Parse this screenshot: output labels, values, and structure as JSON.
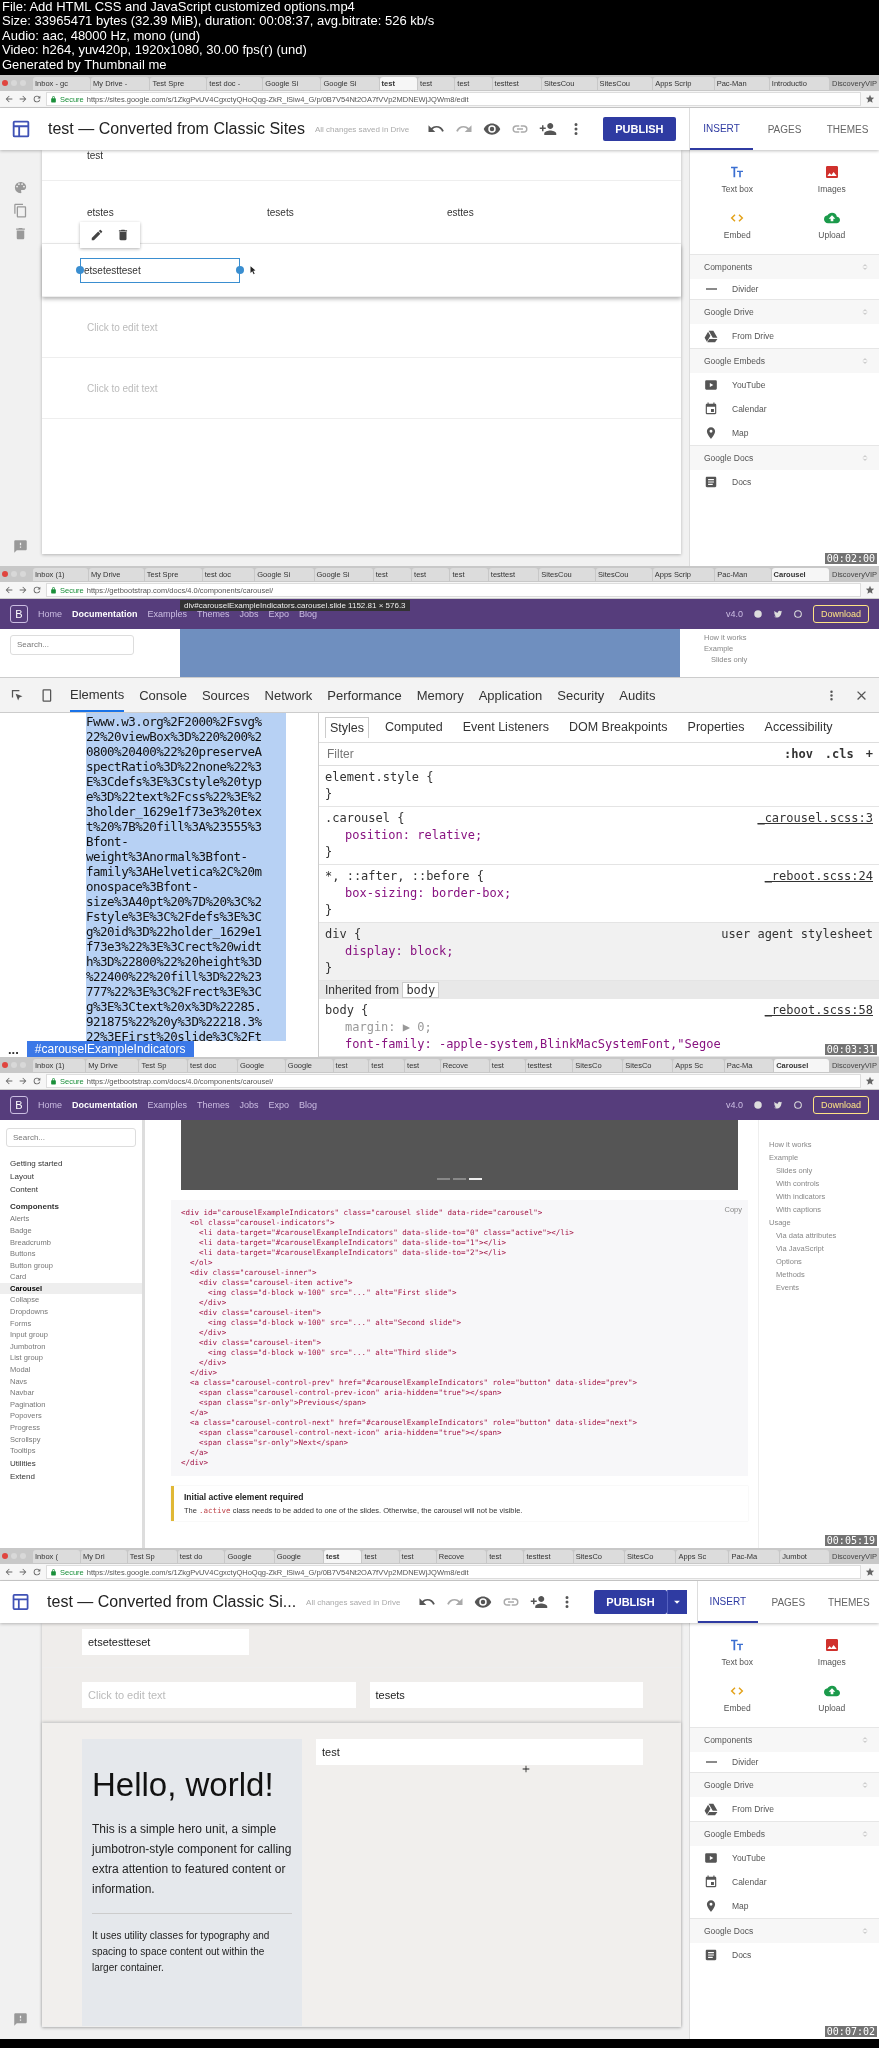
{
  "file_info": [
    "File: Add HTML CSS and JavaScript customized options.mp4",
    "Size: 33965471 bytes (32.39 MiB), duration: 00:08:37, avg.bitrate: 526 kb/s",
    "Audio: aac, 48000 Hz, mono (und)",
    "Video: h264, yuv420p, 1920x1080, 30.00 fps(r) (und)",
    "Generated by Thumbnail me"
  ],
  "frames": [
    {
      "kind": "sites",
      "timestamp": "00:02:00",
      "browser": {
        "tabs": [
          {
            "label": "Inbox - gc",
            "selected": false
          },
          {
            "label": "My Drive -",
            "selected": false
          },
          {
            "label": "Test Spre",
            "selected": false
          },
          {
            "label": "test doc -",
            "selected": false
          },
          {
            "label": "Google Si",
            "selected": false
          },
          {
            "label": "Google Si",
            "selected": false
          },
          {
            "label": "test",
            "selected": true
          },
          {
            "label": "test",
            "selected": false
          },
          {
            "label": "test",
            "selected": false
          },
          {
            "label": "testtest",
            "selected": false
          },
          {
            "label": "SitesCou",
            "selected": false
          },
          {
            "label": "SitesCou",
            "selected": false
          },
          {
            "label": "Apps Scrip",
            "selected": false
          },
          {
            "label": "Pac-Man",
            "selected": false
          },
          {
            "label": "Introductio",
            "selected": false
          }
        ],
        "profile": "DiscoveryVIP",
        "secure": "Secure",
        "url": "https://sites.google.com/s/1ZkgPvUV4CgxctyQHoQqg-ZkR_lSiw4_G/p/0B7V54Nt2OA7fVVp2MDNEWjJQWm8/edit"
      },
      "app": {
        "title": "test — Converted from Classic Sites",
        "save_status": "All changes saved in Drive",
        "publish": "PUBLISH",
        "publish_menu": false
      },
      "panel": {
        "tabs": [
          {
            "label": "INSERT",
            "selected": true
          },
          {
            "label": "PAGES",
            "selected": false
          },
          {
            "label": "THEMES",
            "selected": false
          }
        ],
        "tiles": [
          {
            "label": "Text box",
            "kind": "textbox"
          },
          {
            "label": "Images",
            "kind": "image"
          },
          {
            "label": "Embed",
            "kind": "embed"
          },
          {
            "label": "Upload",
            "kind": "upload"
          }
        ],
        "sections": [
          {
            "title": "Components",
            "items": [
              {
                "label": "Divider",
                "kind": "divider"
              }
            ]
          },
          {
            "title": "Google Drive",
            "items": [
              {
                "label": "From Drive",
                "kind": "drive"
              }
            ]
          },
          {
            "title": "Google Embeds",
            "items": [
              {
                "label": "YouTube",
                "kind": "youtube"
              },
              {
                "label": "Calendar",
                "kind": "calendar"
              },
              {
                "label": "Map",
                "kind": "map"
              }
            ]
          },
          {
            "title": "Google Docs",
            "items": [
              {
                "label": "Docs",
                "kind": "docs"
              }
            ]
          }
        ]
      },
      "canvas": {
        "kind": "text_rows",
        "top_text": "test",
        "columns": [
          "etstes",
          "tesets",
          "esttes"
        ],
        "selected_text": "etsetestteset",
        "placeholders": [
          "Click to edit text",
          "Click to edit text"
        ]
      }
    },
    {
      "kind": "devtools",
      "timestamp": "00:03:31",
      "browser": {
        "tabs": [
          {
            "label": "Inbox (1)",
            "selected": false
          },
          {
            "label": "My Drive",
            "selected": false
          },
          {
            "label": "Test Spre",
            "selected": false
          },
          {
            "label": "test doc",
            "selected": false
          },
          {
            "label": "Google Si",
            "selected": false
          },
          {
            "label": "Google Si",
            "selected": false
          },
          {
            "label": "test",
            "selected": false
          },
          {
            "label": "test",
            "selected": false
          },
          {
            "label": "test",
            "selected": false
          },
          {
            "label": "testtest",
            "selected": false
          },
          {
            "label": "SitesCou",
            "selected": false
          },
          {
            "label": "SitesCou",
            "selected": false
          },
          {
            "label": "Apps Scrip",
            "selected": false
          },
          {
            "label": "Pac-Man",
            "selected": false
          },
          {
            "label": "Carousel",
            "selected": true
          }
        ],
        "profile": "DiscoveryVIP",
        "secure": "Secure",
        "url": "https://getbootstrap.com/docs/4.0/components/carousel/"
      },
      "site": {
        "logo": "B",
        "nav": [
          {
            "label": "Home",
            "selected": false
          },
          {
            "label": "Documentation",
            "selected": true
          },
          {
            "label": "Examples",
            "selected": false
          },
          {
            "label": "Themes",
            "selected": false
          },
          {
            "label": "Jobs",
            "selected": false
          },
          {
            "label": "Expo",
            "selected": false
          },
          {
            "label": "Blog",
            "selected": false
          }
        ],
        "version": "v4.0",
        "download": "Download"
      },
      "tooltip": {
        "selector": "div#carouselExampleIndicators.carousel.slide",
        "size": "1152.81 × 576.3"
      },
      "search_placeholder": "Search...",
      "toc": [
        "How it works",
        "Example",
        "Slides only"
      ],
      "devtools": {
        "tabs": [
          {
            "label": "Elements",
            "selected": true
          },
          {
            "label": "Console",
            "selected": false
          },
          {
            "label": "Sources",
            "selected": false
          },
          {
            "label": "Network",
            "selected": false
          },
          {
            "label": "Performance",
            "selected": false
          },
          {
            "label": "Memory",
            "selected": false
          },
          {
            "label": "Application",
            "selected": false
          },
          {
            "label": "Security",
            "selected": false
          },
          {
            "label": "Audits",
            "selected": false
          }
        ],
        "source_lines": [
          "Fwww.w3.org%2F2000%2Fsvg%",
          "22%20viewBox%3D%220%200%2",
          "0800%20400%22%20preserveA",
          "spectRatio%3D%22none%22%3",
          "E%3Cdefs%3E%3Cstyle%20typ",
          "e%3D%22text%2Fcss%22%3E%2",
          "3holder_1629e1f73e3%20tex",
          "t%20%7B%20fill%3A%23555%3",
          "Bfont-",
          "weight%3Anormal%3Bfont-",
          "family%3AHelvetica%2C%20m",
          "onospace%3Bfont-",
          "size%3A40pt%20%7D%20%3C%2",
          "Fstyle%3E%3C%2Fdefs%3E%3C",
          "g%20id%3D%22holder_1629e1",
          "f73e3%22%3E%3Crect%20widt",
          "h%3D%22800%22%20height%3D",
          "%22400%22%20fill%3D%22%23",
          "777%22%3E%3C%2Frect%3E%3C",
          "g%3E%3Ctext%20x%3D%22285.",
          "921875%22%20y%3D%22218.3%",
          "22%3EFirst%20slide%3C%2Ft"
        ],
        "breadcrumb_more": "...",
        "breadcrumb": "#carouselExampleIndicators",
        "pane_tabs": [
          {
            "label": "Styles",
            "selected": true
          },
          {
            "label": "Computed",
            "selected": false
          },
          {
            "label": "Event Listeners",
            "selected": false
          },
          {
            "label": "DOM Breakpoints",
            "selected": false
          },
          {
            "label": "Properties",
            "selected": false
          },
          {
            "label": "Accessibility",
            "selected": false
          }
        ],
        "filter_placeholder": "Filter",
        "hov": ":hov",
        "cls": ".cls",
        "add": "+",
        "rules": [
          {
            "head": "element.style {",
            "tail": "}",
            "shaded": false
          },
          {
            "head": ".carousel {",
            "props": [
              "position: relative;"
            ],
            "tail": "}",
            "source": "_carousel.scss:3",
            "shaded": false
          },
          {
            "head": "*, ::after, ::before {",
            "props": [
              "box-sizing: border-box;"
            ],
            "tail": "}",
            "source": "_reboot.scss:24",
            "shaded": false
          },
          {
            "head": "div {",
            "props": [
              "display: block;"
            ],
            "tail": "}",
            "source": "user agent stylesheet",
            "shaded": true
          }
        ],
        "inherited_label": "Inherited from",
        "inherited_tag": "body",
        "body_rule": {
          "head": "body {",
          "props": [
            "margin: ▶ 0;",
            "font-family: -apple-system,BlinkMacSystemFont,\"Segoe"
          ],
          "source": "_reboot.scss:58"
        }
      }
    },
    {
      "kind": "docs",
      "timestamp": "00:05:19",
      "browser": {
        "tabs": [
          {
            "label": "Inbox (1)",
            "selected": false
          },
          {
            "label": "My Drive",
            "selected": false
          },
          {
            "label": "Test Sp",
            "selected": false
          },
          {
            "label": "test doc",
            "selected": false
          },
          {
            "label": "Google",
            "selected": false
          },
          {
            "label": "Google",
            "selected": false
          },
          {
            "label": "test",
            "selected": false
          },
          {
            "label": "test",
            "selected": false
          },
          {
            "label": "test",
            "selected": false
          },
          {
            "label": "Recove",
            "selected": false
          },
          {
            "label": "test",
            "selected": false
          },
          {
            "label": "testtest",
            "selected": false
          },
          {
            "label": "SitesCo",
            "selected": false
          },
          {
            "label": "SitesCo",
            "selected": false
          },
          {
            "label": "Apps Sc",
            "selected": false
          },
          {
            "label": "Pac-Ma",
            "selected": false
          },
          {
            "label": "Carousel",
            "selected": true
          }
        ],
        "profile": "DiscoveryVIP",
        "secure": "Secure",
        "url": "https://getbootstrap.com/docs/4.0/components/carousel/"
      },
      "site": {
        "logo": "B",
        "nav": [
          {
            "label": "Home",
            "selected": false
          },
          {
            "label": "Documentation",
            "selected": true
          },
          {
            "label": "Examples",
            "selected": false
          },
          {
            "label": "Themes",
            "selected": false
          },
          {
            "label": "Jobs",
            "selected": false
          },
          {
            "label": "Expo",
            "selected": false
          },
          {
            "label": "Blog",
            "selected": false
          }
        ],
        "version": "v4.0",
        "download": "Download"
      },
      "search_placeholder": "Search...",
      "sidebar": [
        {
          "label": "Getting started",
          "kind": "group",
          "selected": false
        },
        {
          "label": "Layout",
          "kind": "group",
          "selected": false
        },
        {
          "label": "Content",
          "kind": "group",
          "selected": false
        },
        {
          "label": "Components",
          "kind": "heading",
          "selected": false
        },
        {
          "label": "Alerts",
          "kind": "link",
          "selected": false
        },
        {
          "label": "Badge",
          "kind": "link",
          "selected": false
        },
        {
          "label": "Breadcrumb",
          "kind": "link",
          "selected": false
        },
        {
          "label": "Buttons",
          "kind": "link",
          "selected": false
        },
        {
          "label": "Button group",
          "kind": "link",
          "selected": false
        },
        {
          "label": "Card",
          "kind": "link",
          "selected": false
        },
        {
          "label": "Carousel",
          "kind": "link",
          "selected": true
        },
        {
          "label": "Collapse",
          "kind": "link",
          "selected": false
        },
        {
          "label": "Dropdowns",
          "kind": "link",
          "selected": false
        },
        {
          "label": "Forms",
          "kind": "link",
          "selected": false
        },
        {
          "label": "Input group",
          "kind": "link",
          "selected": false
        },
        {
          "label": "Jumbotron",
          "kind": "link",
          "selected": false
        },
        {
          "label": "List group",
          "kind": "link",
          "selected": false
        },
        {
          "label": "Modal",
          "kind": "link",
          "selected": false
        },
        {
          "label": "Navs",
          "kind": "link",
          "selected": false
        },
        {
          "label": "Navbar",
          "kind": "link",
          "selected": false
        },
        {
          "label": "Pagination",
          "kind": "link",
          "selected": false
        },
        {
          "label": "Popovers",
          "kind": "link",
          "selected": false
        },
        {
          "label": "Progress",
          "kind": "link",
          "selected": false
        },
        {
          "label": "Scrollspy",
          "kind": "link",
          "selected": false
        },
        {
          "label": "Tooltips",
          "kind": "link",
          "selected": false
        },
        {
          "label": "Utilities",
          "kind": "group",
          "selected": false
        },
        {
          "label": "Extend",
          "kind": "group",
          "selected": false
        }
      ],
      "indicators": [
        {
          "selected": false
        },
        {
          "selected": false
        },
        {
          "selected": true
        }
      ],
      "copy": "Copy",
      "code": [
        "<div id=\"carouselExampleIndicators\" class=\"carousel slide\" data-ride=\"carousel\">",
        "  <ol class=\"carousel-indicators\">",
        "    <li data-target=\"#carouselExampleIndicators\" data-slide-to=\"0\" class=\"active\"></li>",
        "    <li data-target=\"#carouselExampleIndicators\" data-slide-to=\"1\"></li>",
        "    <li data-target=\"#carouselExampleIndicators\" data-slide-to=\"2\"></li>",
        "  </ol>",
        "  <div class=\"carousel-inner\">",
        "    <div class=\"carousel-item active\">",
        "      <img class=\"d-block w-100\" src=\"...\" alt=\"First slide\">",
        "    </div>",
        "    <div class=\"carousel-item\">",
        "      <img class=\"d-block w-100\" src=\"...\" alt=\"Second slide\">",
        "    </div>",
        "    <div class=\"carousel-item\">",
        "      <img class=\"d-block w-100\" src=\"...\" alt=\"Third slide\">",
        "    </div>",
        "  </div>",
        "  <a class=\"carousel-control-prev\" href=\"#carouselExampleIndicators\" role=\"button\" data-slide=\"prev\">",
        "    <span class=\"carousel-control-prev-icon\" aria-hidden=\"true\"></span>",
        "    <span class=\"sr-only\">Previous</span>",
        "  </a>",
        "  <a class=\"carousel-control-next\" href=\"#carouselExampleIndicators\" role=\"button\" data-slide=\"next\">",
        "    <span class=\"carousel-control-next-icon\" aria-hidden=\"true\"></span>",
        "    <span class=\"sr-only\">Next</span>",
        "  </a>",
        "</div>"
      ],
      "callout": {
        "title": "Initial active element required",
        "text_before": "The",
        "code": ".active",
        "text_after": "class needs to be added to one of the slides. Otherwise, the carousel will not be visible."
      },
      "toc": [
        {
          "label": "How it works",
          "kind": "top"
        },
        {
          "label": "Example",
          "kind": "top"
        },
        {
          "label": "Slides only",
          "kind": "sub"
        },
        {
          "label": "With controls",
          "kind": "sub"
        },
        {
          "label": "With indicators",
          "kind": "sub"
        },
        {
          "label": "With captions",
          "kind": "sub"
        },
        {
          "label": "Usage",
          "kind": "top"
        },
        {
          "label": "Via data attributes",
          "kind": "sub"
        },
        {
          "label": "Via JavaScript",
          "kind": "sub"
        },
        {
          "label": "Options",
          "kind": "sub"
        },
        {
          "label": "Methods",
          "kind": "sub"
        },
        {
          "label": "Events",
          "kind": "sub"
        }
      ]
    },
    {
      "kind": "sites",
      "timestamp": "00:07:02",
      "browser": {
        "tabs": [
          {
            "label": "Inbox (",
            "selected": false
          },
          {
            "label": "My Dri",
            "selected": false
          },
          {
            "label": "Test Sp",
            "selected": false
          },
          {
            "label": "test do",
            "selected": false
          },
          {
            "label": "Google",
            "selected": false
          },
          {
            "label": "Google",
            "selected": false
          },
          {
            "label": "test",
            "selected": true
          },
          {
            "label": "test",
            "selected": false
          },
          {
            "label": "test",
            "selected": false
          },
          {
            "label": "Recove",
            "selected": false
          },
          {
            "label": "test",
            "selected": false
          },
          {
            "label": "testtest",
            "selected": false
          },
          {
            "label": "SitesCo",
            "selected": false
          },
          {
            "label": "SitesCo",
            "selected": false
          },
          {
            "label": "Apps Sc",
            "selected": false
          },
          {
            "label": "Pac-Ma",
            "selected": false
          },
          {
            "label": "Jumbot",
            "selected": false
          }
        ],
        "profile": "DiscoveryVIP",
        "secure": "Secure",
        "url": "https://sites.google.com/s/1ZkgPvUV4CgxctyQHoQqg-ZkR_lSiw4_G/p/0B7V54Nt2OA7fVVp2MDNEWjJQWm8/edit"
      },
      "app": {
        "title": "test — Converted from Classic Si...",
        "save_status": "All changes saved in Drive",
        "publish": "PUBLISH",
        "publish_menu": true
      },
      "panel": {
        "tabs": [
          {
            "label": "INSERT",
            "selected": true
          },
          {
            "label": "PAGES",
            "selected": false
          },
          {
            "label": "THEMES",
            "selected": false
          }
        ],
        "tiles": [
          {
            "label": "Text box",
            "kind": "textbox"
          },
          {
            "label": "Images",
            "kind": "image"
          },
          {
            "label": "Embed",
            "kind": "embed"
          },
          {
            "label": "Upload",
            "kind": "upload"
          }
        ],
        "sections": [
          {
            "title": "Components",
            "items": [
              {
                "label": "Divider",
                "kind": "divider"
              }
            ]
          },
          {
            "title": "Google Drive",
            "items": [
              {
                "label": "From Drive",
                "kind": "drive"
              }
            ]
          },
          {
            "title": "Google Embeds",
            "items": [
              {
                "label": "YouTube",
                "kind": "youtube"
              },
              {
                "label": "Calendar",
                "kind": "calendar"
              },
              {
                "label": "Map",
                "kind": "map"
              }
            ]
          },
          {
            "title": "Google Docs",
            "items": [
              {
                "label": "Docs",
                "kind": "docs"
              }
            ]
          }
        ]
      },
      "canvas": {
        "kind": "jumbotron",
        "first_text": "etsetestteset",
        "placeholder": "Click to edit text",
        "second_text": "tesets",
        "heading": "Hello, world!",
        "lead": "This is a simple hero unit, a simple jumbotron-style component for calling extra attention to featured content or information.",
        "body": "It uses utility classes for typography and spacing to space content out within the larger container.",
        "side_text": "test"
      }
    }
  ]
}
